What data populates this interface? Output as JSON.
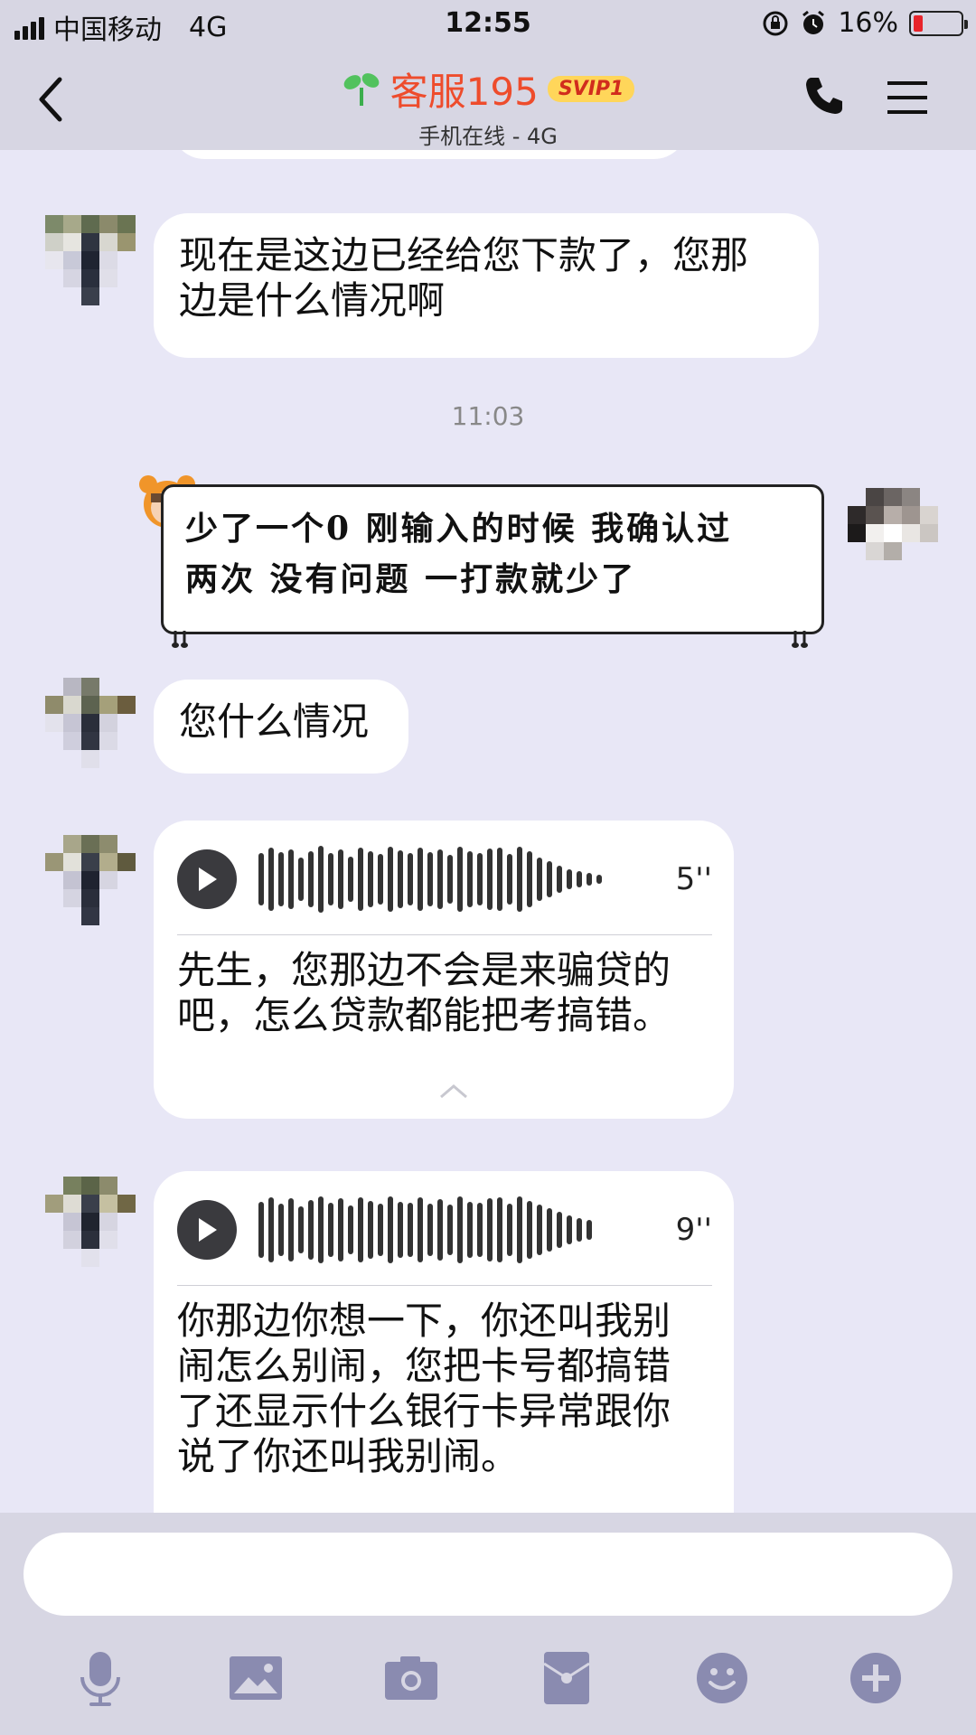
{
  "status": {
    "carrier": "中国移动",
    "network": "4G",
    "time": "12:55",
    "battery": "16%"
  },
  "header": {
    "title": "客服195",
    "badge": "SVIP1",
    "subtitle": "手机在线 - 4G"
  },
  "messages": [
    {
      "side": "left",
      "type": "text",
      "text_lines": [
        "现在是这边已经给您下款了，您那",
        "边是什么情况啊"
      ]
    },
    {
      "type": "timestamp",
      "text": "11:03"
    },
    {
      "side": "right",
      "type": "text",
      "text_lines": [
        "少了一个0 刚输入的时候 我确认过",
        "两次 没有问题 一打款就少了"
      ]
    },
    {
      "side": "left",
      "type": "text",
      "text": "您什么情况"
    },
    {
      "side": "left",
      "type": "voice",
      "duration": "5''",
      "transcript_lines": [
        "先生，您那边不会是来骗贷的",
        "吧，怎么贷款都能把考搞错。"
      ]
    },
    {
      "side": "left",
      "type": "voice",
      "duration": "9''",
      "transcript_lines": [
        "你那边你想一下，你还叫我别",
        "闹怎么别闹，您把卡号都搞错",
        "了还显示什么银行卡异常跟你",
        "说了你还叫我别闹。"
      ]
    }
  ],
  "toolbar": {
    "icons": [
      "microphone-icon",
      "image-icon",
      "camera-icon",
      "red-packet-icon",
      "emoji-icon",
      "plus-icon"
    ]
  },
  "colors": {
    "title": "#ee4c2c",
    "badge_bg": "#ffd65a",
    "chat_bg": "#e8e7f6",
    "bar_bg": "#d7d6e3",
    "icon": "#8a8bb0"
  }
}
